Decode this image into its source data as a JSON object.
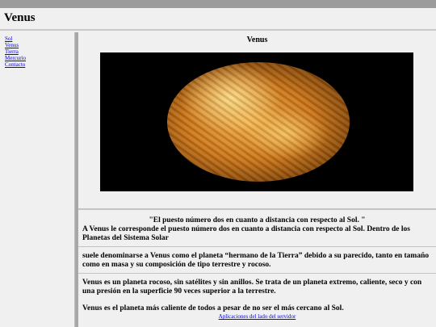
{
  "header": {
    "title": "Venus"
  },
  "sidebar": {
    "items": [
      {
        "label": "Sol"
      },
      {
        "label": "Venus"
      },
      {
        "label": "Tierra"
      },
      {
        "label": "Mercurio"
      },
      {
        "label": "Contacto"
      }
    ]
  },
  "main": {
    "image_title": "Venus",
    "quote": "\"El puesto número dos en cuanto a distancia con respecto al Sol. \"",
    "paragraph1": "A Venus le corresponde el puesto número dos en cuanto a distancia con respecto al Sol. Dentro de los Planetas del Sistema Solar",
    "paragraph2": "suele denominarse a Venus como el planeta “hermano de la Tierra” debido a su parecido, tanto en tamaño como en masa y su composición de tipo terrestre y rocoso.",
    "paragraph3": "Venus es un planeta rocoso, sin satélites y sin anillos. Se trata de un planeta extremo, caliente, seco y con una presión en la superficie 90 veces superior a la terrestre.",
    "paragraph4": "Venus es el planeta más caliente de todos a pesar de no ser el más cercano al Sol.",
    "footer_link": "Aplicaciones del lado del servidor"
  }
}
